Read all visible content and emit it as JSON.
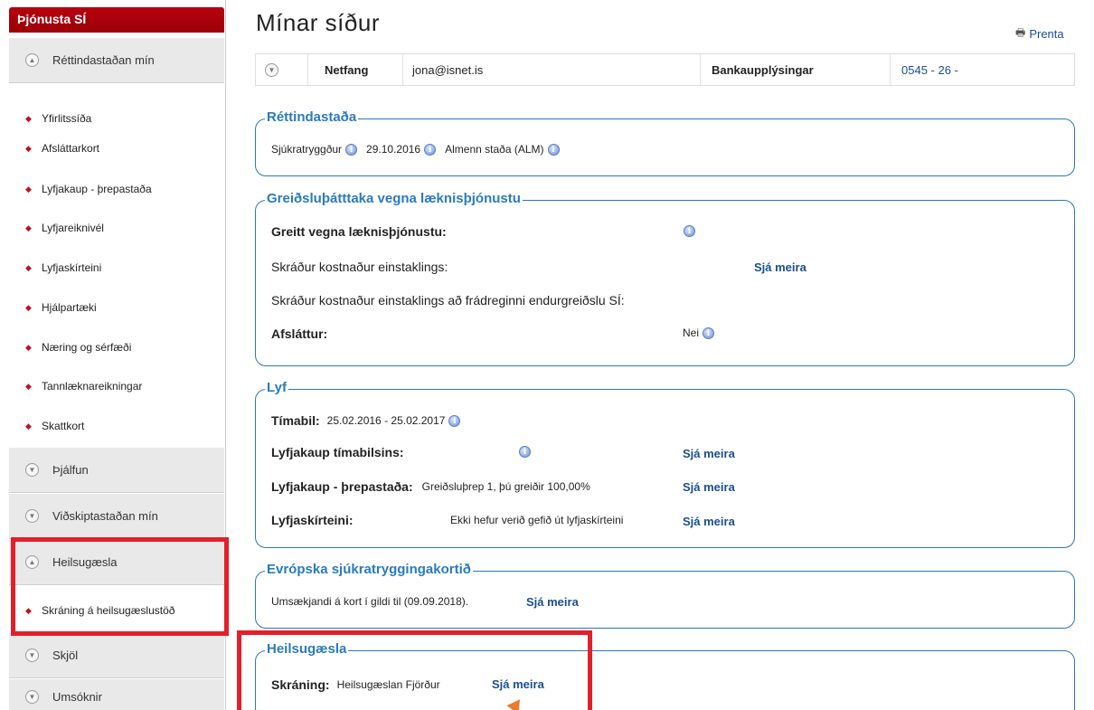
{
  "sidebar": {
    "title": "Þjónusta SÍ",
    "sections": {
      "rettindastada": "Réttindastaðan mín",
      "thjalfun": "Þjálfun",
      "vidskiptastada": "Viðskiptastaðan mín",
      "heilsugaesla": "Heilsugæsla",
      "skjol": "Skjöl",
      "umsoknir": "Umsóknir"
    },
    "items": [
      "Yfirlitssíða",
      "Afsláttarkort",
      "Lyfjakaup - þrepastaða",
      "Lyfjareiknivél",
      "Lyfjaskírteini",
      "Hjálpartæki",
      "Næring og sérfæði",
      "Tannlæknareikningar",
      "Skattkort"
    ],
    "heilsugaesla_item": "Skráning á heilsugæslustöð"
  },
  "header": {
    "title": "Mínar síður",
    "print_label": "Prenta"
  },
  "info_bar": {
    "email_label": "Netfang",
    "email_value": "jona@isnet.is",
    "bank_label": "Bankaupplýsingar",
    "bank_value": "0545 - 26 -"
  },
  "rettindastada": {
    "title": "Réttindastaða",
    "insured": "Sjúkratryggður",
    "date": "29.10.2016",
    "status": "Almenn staða (ALM)"
  },
  "greidsluthatttaka": {
    "title": "Greiðsluþátttaka vegna læknisþjónustu",
    "paid_label": "Greitt vegna læknisþjónustu:",
    "registered_cost": "Skráður kostnaður einstaklings:",
    "registered_cost_deducted": "Skráður kostnaður einstaklings að frádreginni endurgreiðslu SÍ:",
    "discount_label": "Afsláttur:",
    "discount_value": "Nei",
    "see_more": "Sjá meira"
  },
  "lyf": {
    "title": "Lyf",
    "period_label": "Tímabil:",
    "period_value": "25.02.2016 - 25.02.2017",
    "purchases_label": "Lyfjakaup tímabilsins:",
    "step_label": "Lyfjakaup - þrepastaða:",
    "step_value": "Greiðsluþrep 1, þú greiðir 100,00%",
    "cert_label": "Lyfjaskírteini:",
    "cert_value": "Ekki hefur verið gefið út lyfjaskírteini",
    "see_more": "Sjá meira"
  },
  "evropska": {
    "title": "Evrópska sjúkratryggingakortið",
    "text": "Umsækjandi á kort í gildi til (09.09.2018).",
    "see_more": "Sjá meira"
  },
  "heilsugaesla": {
    "title": "Heilsugæsla",
    "reg_label": "Skráning:",
    "reg_value": "Heilsugæslan Fjörður",
    "see_more": "Sjá meira"
  },
  "colors": {
    "brand_red": "#b8000e",
    "link_blue": "#1a4f8f",
    "section_blue": "#2a7bbd",
    "highlight": "#e2202a",
    "arrow": "#ee7a2b"
  }
}
